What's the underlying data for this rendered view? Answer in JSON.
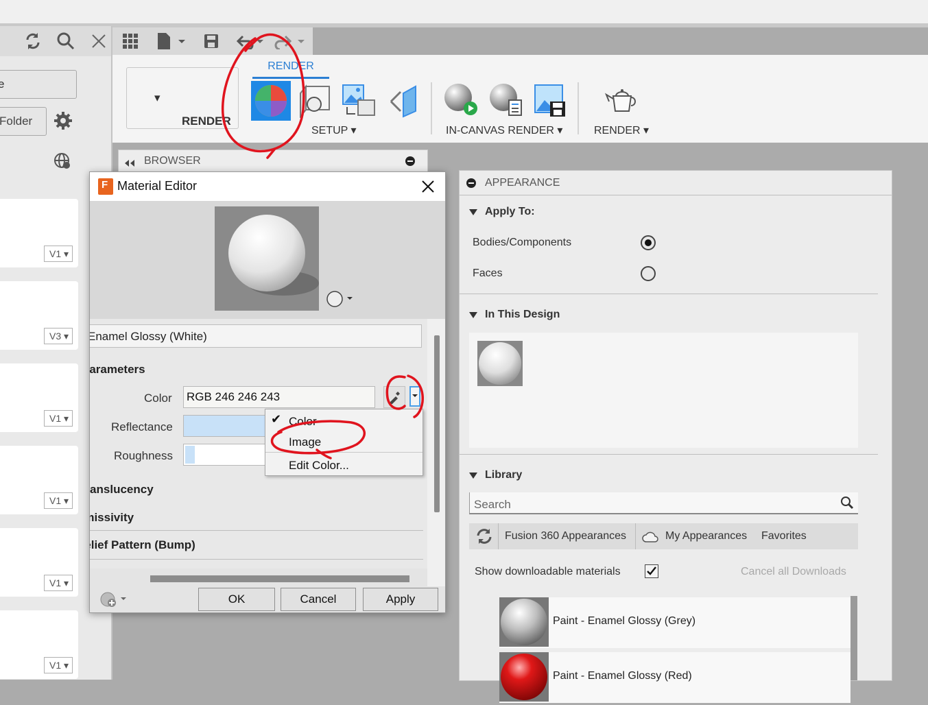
{
  "left_panel": {
    "project_select": "e",
    "new_folder_label": "Folder",
    "versions": [
      "V1",
      "V3",
      "V1",
      "V1",
      "V1",
      "V1"
    ]
  },
  "toolbar": {
    "workspace_label": "RENDER",
    "render_tab_label": "RENDER",
    "setup_label": "SETUP",
    "in_canvas_render_label": "IN-CANVAS RENDER",
    "render_label": "RENDER"
  },
  "browser": {
    "title": "BROWSER"
  },
  "material_editor": {
    "title": "Material Editor",
    "material_name": "Enamel Glossy (White)",
    "parameters_heading": "Parameters",
    "color_label": "Color",
    "color_value": "RGB 246 246 243",
    "reflectance_label": "Reflectance",
    "reflectance_fraction": 0.38,
    "roughness_label": "Roughness",
    "roughness_fraction": 0.05,
    "translucency_heading": "Translucency",
    "emissivity_heading": "Emissivity",
    "relief_heading": "Relief Pattern (Bump)",
    "buttons": {
      "ok": "OK",
      "cancel": "Cancel",
      "apply": "Apply"
    },
    "color_menu": {
      "items": [
        "Color",
        "Image",
        "Edit Color..."
      ],
      "checked": "Color"
    }
  },
  "appearance": {
    "title": "APPEARANCE",
    "apply_to_heading": "Apply To:",
    "bodies_label": "Bodies/Components",
    "faces_label": "Faces",
    "selected_target": "Bodies/Components",
    "in_this_design_heading": "In This Design",
    "library_heading": "Library",
    "search_placeholder": "Search",
    "library_tabs": [
      "Fusion 360 Appearances",
      "My Appearances",
      "Favorites"
    ],
    "show_downloadable_label": "Show downloadable materials",
    "show_downloadable_checked": true,
    "cancel_downloads_label": "Cancel all Downloads",
    "items": [
      {
        "name": "Paint - Enamel Glossy (Grey)",
        "color": "#9a9a9a"
      },
      {
        "name": "Paint - Enamel Glossy (Red)",
        "color": "#cc1111"
      }
    ]
  },
  "colors": {
    "accent": "#2b7fd3",
    "annotation": "#e0141e"
  }
}
